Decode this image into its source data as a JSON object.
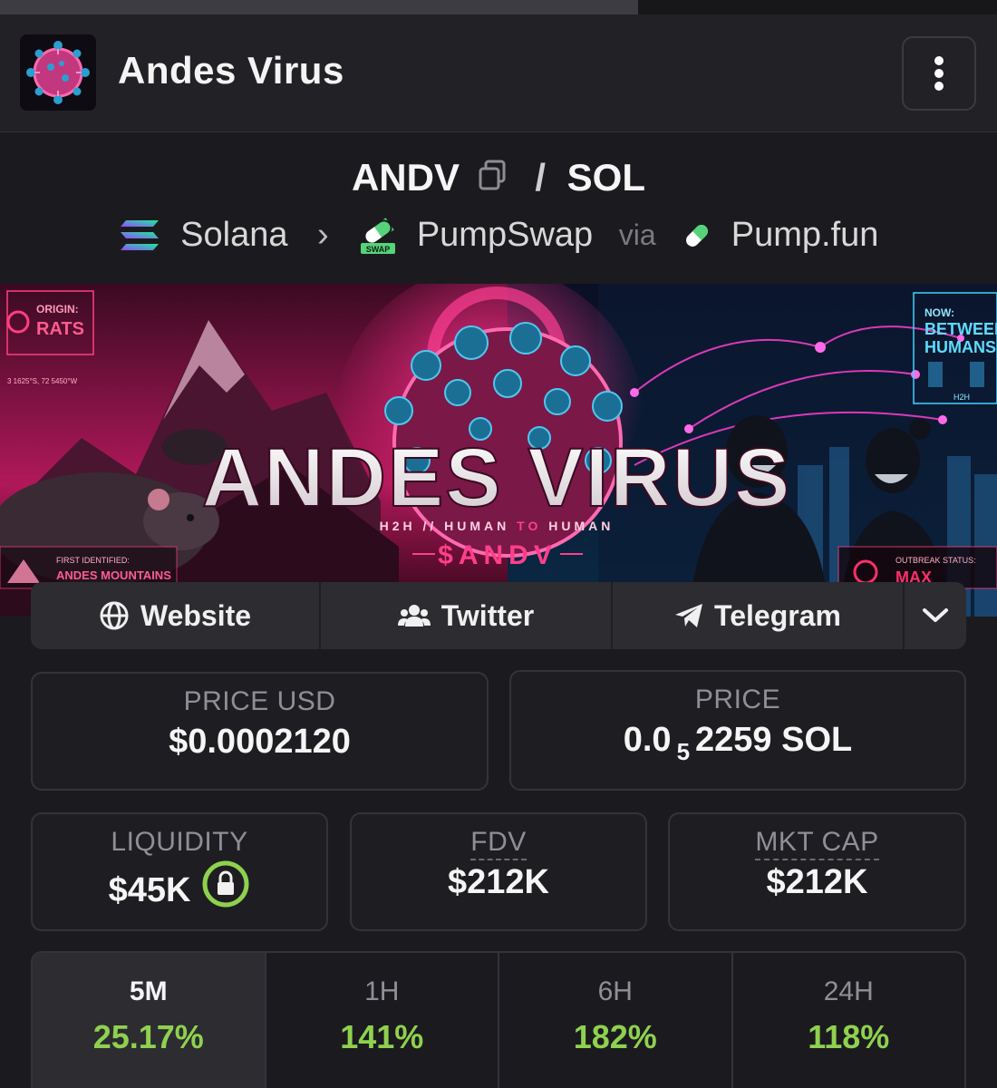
{
  "header": {
    "title": "Andes Virus",
    "menu_icon": "more-vertical-icon",
    "progress_fraction": 0.64
  },
  "pair": {
    "base": "ANDV",
    "separator": "/",
    "quote": "SOL"
  },
  "chain": {
    "network": "Solana",
    "dex": "PumpSwap",
    "dex_badge": "SWAP",
    "via_label": "via",
    "launchpad": "Pump.fun"
  },
  "banner": {
    "title": "ANDES VIRUS",
    "tagline_a": "H2H // HUMAN ",
    "tagline_to": "TO",
    "tagline_b": " HUMAN",
    "ticker": "$ANDV",
    "origin_label": "ORIGIN:",
    "origin_value": "RATS",
    "coords": "3 1625°S, 72 5450°W",
    "now_label": "NOW:",
    "now_value_1": "BETWEEN",
    "now_value_2": "HUMANS",
    "h2h_label": "H2H",
    "first_label": "FIRST IDENTIFIED:",
    "first_value": "ANDES MOUNTAINS",
    "status_label": "OUTBREAK STATUS:",
    "status_value": "MAX"
  },
  "links": {
    "website": "Website",
    "twitter": "Twitter",
    "telegram": "Telegram"
  },
  "stats": {
    "price_usd_label": "PRICE USD",
    "price_usd_value": "$0.0002120",
    "price_label": "PRICE",
    "price_prefix": "0.0",
    "price_zeros": "5",
    "price_digits": "2259",
    "price_unit": "SOL",
    "liquidity_label": "LIQUIDITY",
    "liquidity_value": "$45K",
    "fdv_label": "FDV",
    "fdv_value": "$212K",
    "mcap_label": "MKT CAP",
    "mcap_value": "$212K"
  },
  "timeframes": [
    {
      "label": "5M",
      "value": "25.17%",
      "active": true
    },
    {
      "label": "1H",
      "value": "141%",
      "active": false
    },
    {
      "label": "6H",
      "value": "182%",
      "active": false
    },
    {
      "label": "24H",
      "value": "118%",
      "active": false
    }
  ],
  "colors": {
    "positive": "#8fd14f",
    "accent_pink": "#ff2f8a",
    "accent_cyan": "#3fd4ff",
    "lock_green": "#8fd14f"
  }
}
